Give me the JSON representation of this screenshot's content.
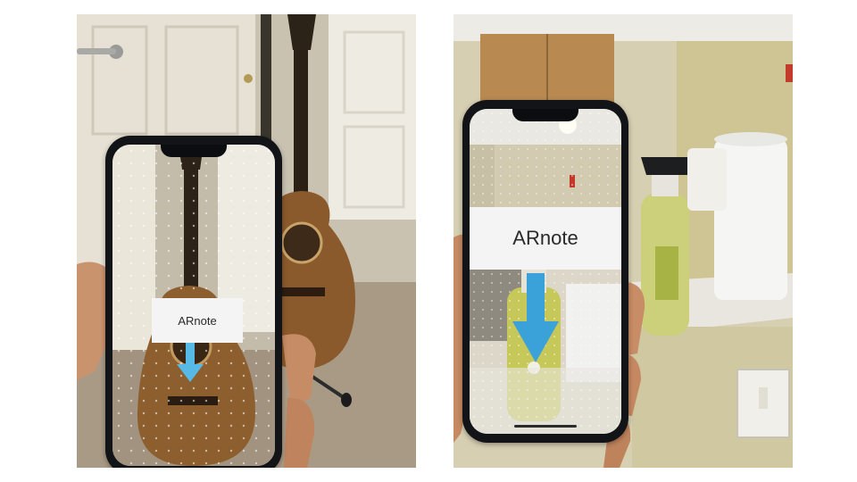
{
  "panels": [
    {
      "name": "guitar-scene",
      "ar_label": "ARnote",
      "arrow_color": "#57b9e6"
    },
    {
      "name": "kitchen-scene",
      "ar_label": "ARnote",
      "arrow_color": "#3aa2d8"
    }
  ],
  "colors": {
    "door_white": "#e7e2d4",
    "wall": "#d9d1b6",
    "guitar_wood": "#8a5a2c",
    "phone_frame": "#121418",
    "bottle_green": "#c7c95a",
    "cabinet_wood": "#b98b52"
  }
}
